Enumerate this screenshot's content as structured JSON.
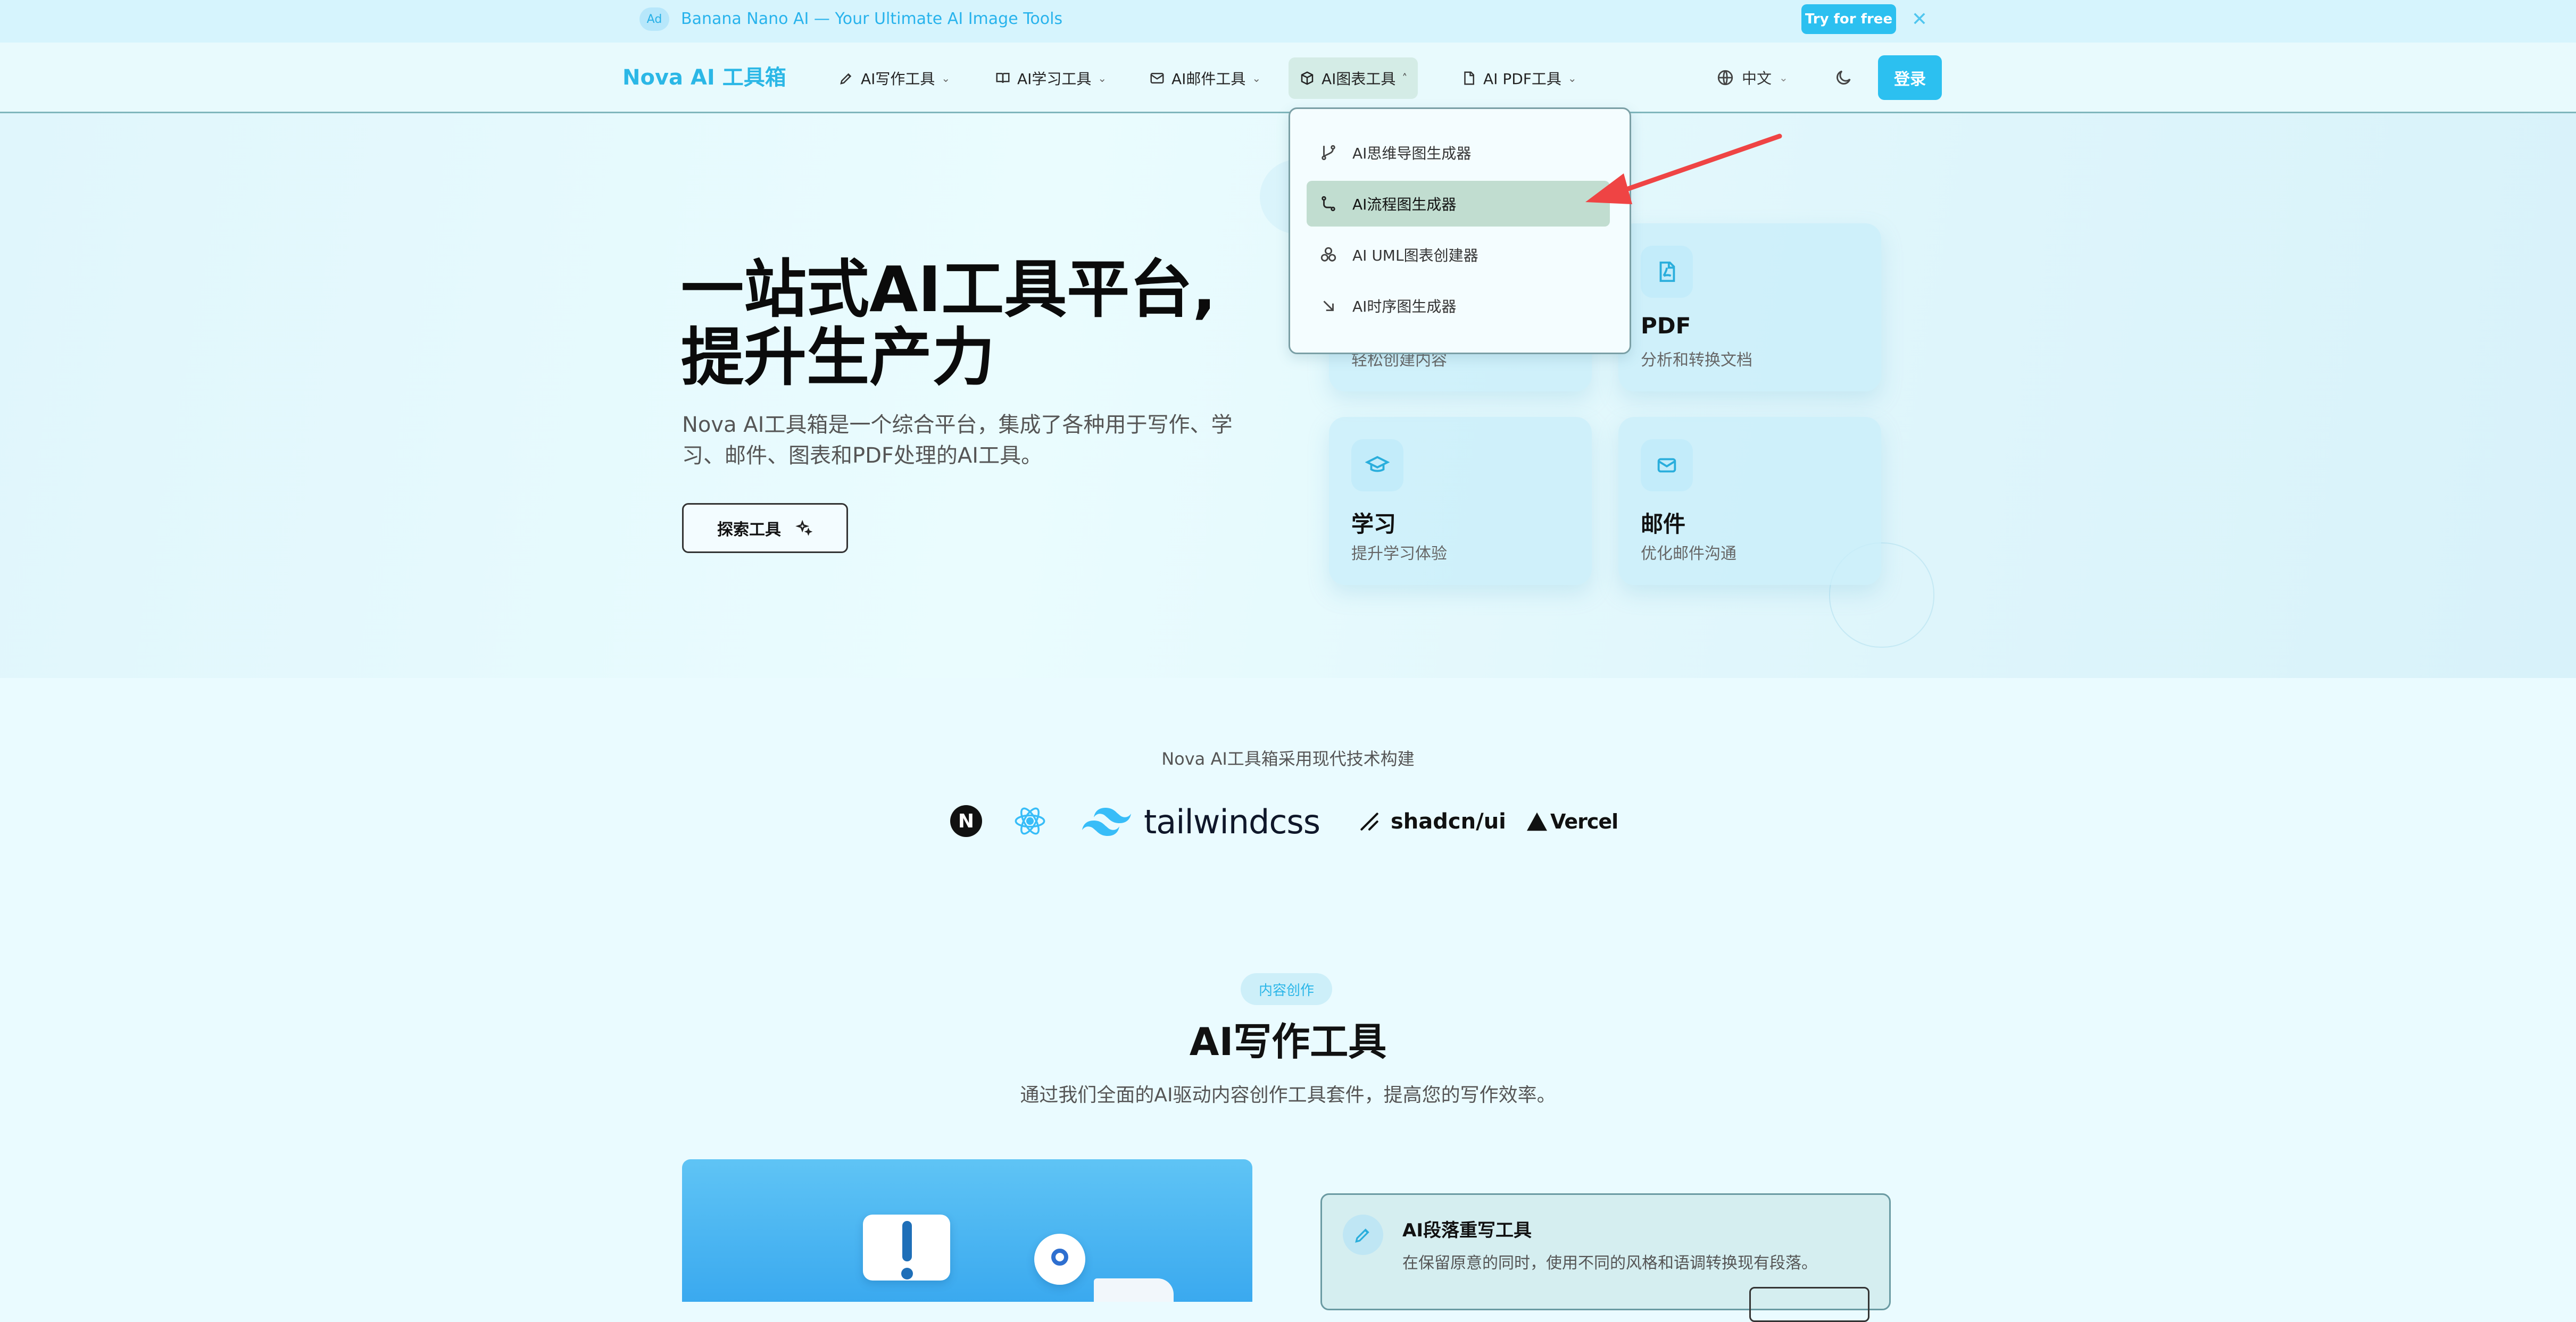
{
  "ad": {
    "badge": "Ad",
    "text": "Banana Nano AI — Your Ultimate AI Image Tools",
    "cta": "Try for free",
    "close": "✕"
  },
  "header": {
    "logo": "Nova AI 工具箱",
    "nav": [
      {
        "label": "AI写作工具",
        "icon": "pen-icon"
      },
      {
        "label": "AI学习工具",
        "icon": "book-icon"
      },
      {
        "label": "AI邮件工具",
        "icon": "mail-icon"
      },
      {
        "label": "AI图表工具",
        "icon": "cube-icon",
        "active": true
      },
      {
        "label": "AI PDF工具",
        "icon": "file-icon"
      }
    ],
    "language": "中文",
    "login": "登录"
  },
  "dropdown": {
    "items": [
      {
        "label": "AI思维导图生成器",
        "icon": "git-branch-icon"
      },
      {
        "label": "AI流程图生成器",
        "icon": "workflow-icon",
        "highlighted": true
      },
      {
        "label": "AI UML图表创建器",
        "icon": "circles-icon"
      },
      {
        "label": "AI时序图生成器",
        "icon": "arrow-down-right-icon"
      }
    ]
  },
  "hero": {
    "title_line1": "一站式AI工具平台,",
    "title_line2": "提升生产力",
    "desc": "Nova AI工具箱是一个综合平台，集成了各种用于写作、学习、邮件、图表和PDF处理的AI工具。",
    "explore": "探索工具",
    "cards": [
      {
        "title": "",
        "sub": "轻松创建内容",
        "icon": "pen-icon"
      },
      {
        "title": "PDF",
        "sub": "分析和转换文档",
        "icon": "pdf-icon"
      },
      {
        "title": "学习",
        "sub": "提升学习体验",
        "icon": "graduation-cap-icon"
      },
      {
        "title": "邮件",
        "sub": "优化邮件沟通",
        "icon": "mail-open-icon"
      }
    ]
  },
  "tech": {
    "label": "Nova AI工具箱采用现代技术构建",
    "logos": [
      "tailwindcss",
      "shadcn/ui",
      "Vercel"
    ]
  },
  "writing": {
    "pill": "内容创作",
    "title": "AI写作工具",
    "desc": "通过我们全面的AI驱动内容创作工具套件，提高您的写作效率。",
    "tool": {
      "title": "AI段落重写工具",
      "desc": "在保留原意的同时，使用不同的风格和语调转换现有段落。"
    }
  },
  "colors": {
    "accent": "#2cc0f0",
    "background": "#eafbff",
    "highlight": "#c1ddd0"
  }
}
